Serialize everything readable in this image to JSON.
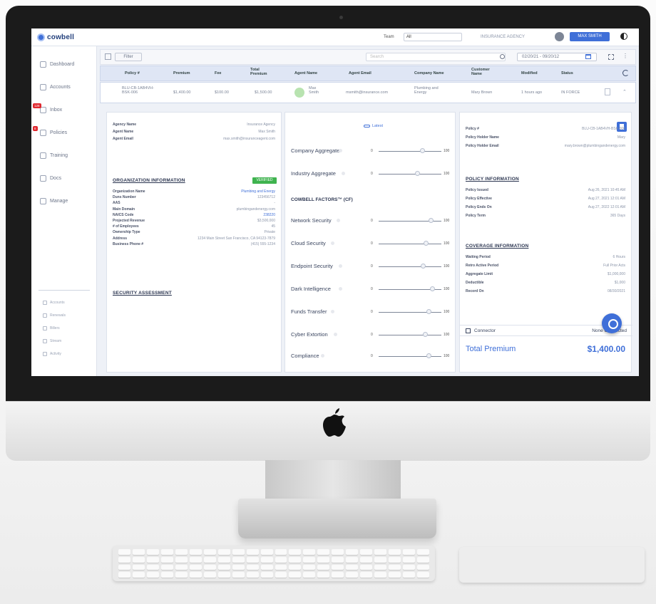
{
  "app": {
    "brand": "cowbell"
  },
  "topbar": {
    "team_label": "Team",
    "team_value": "All",
    "agency": "INSURANCE AGENCY",
    "user_button": "MAX SMITH"
  },
  "nav": [
    {
      "label": "Dashboard"
    },
    {
      "label": "Accounts"
    },
    {
      "label": "Inbox",
      "badge": "128"
    },
    {
      "label": "Policies",
      "badge": "8"
    },
    {
      "label": "Training"
    },
    {
      "label": "Docs"
    },
    {
      "label": "Manage"
    }
  ],
  "nav_secondary": [
    {
      "label": "Accounts"
    },
    {
      "label": "Renewals"
    },
    {
      "label": "Billers"
    },
    {
      "label": "Stream"
    },
    {
      "label": "Activity"
    }
  ],
  "filterbar": {
    "filter_label": "Filter",
    "search_placeholder": "Search",
    "date_range": "02/20/21 - 09/20/12"
  },
  "table": {
    "headers": [
      "Policy #",
      "Premium",
      "Fee",
      "Total Premium",
      "Agent Name",
      "Agent Email",
      "Company Name",
      "Customer Name",
      "Modified",
      "Status"
    ],
    "row": {
      "policy": "BLU-CB-1AB4VH-BSK-006",
      "premium": "$1,400.00",
      "fee": "$100.00",
      "total": "$1,500.00",
      "agent_name": "Max Smith",
      "agent_email": "msmith@insurance.com",
      "company": "Plumbing and Energy",
      "customer": "Mary Brown",
      "modified": "1 hours ago",
      "status": "IN FORCE"
    }
  },
  "left_panel": {
    "agency": [
      {
        "k": "Agency Name",
        "v": "Insurance Agency"
      },
      {
        "k": "Agent Name",
        "v": "Max Smith"
      },
      {
        "k": "Agent Email",
        "v": "max.smith@insuranceagent.com"
      }
    ],
    "org_title": "ORGANIZATION INFORMATION",
    "verified": "VERIFIED",
    "org": [
      {
        "k": "Organization Name",
        "v": "Plumbing and Energy",
        "link": true
      },
      {
        "k": "Duns Number",
        "v": "123456712"
      },
      {
        "k": "AAS",
        "v": "-"
      },
      {
        "k": "Main Domain",
        "v": "plumbingandenergy.com"
      },
      {
        "k": "NAICS Code",
        "v": "238220",
        "link": true
      },
      {
        "k": "Projected Revenue",
        "v": "$3,500,000"
      },
      {
        "k": "# of Employees",
        "v": "45"
      },
      {
        "k": "Ownership Type",
        "v": "Private"
      },
      {
        "k": "Address",
        "v": "1234 Main Street San Francisco, CA 94123-7879"
      },
      {
        "k": "Business Phone #",
        "v": "(415) 555-1234"
      }
    ],
    "security_title": "SECURITY ASSESSMENT"
  },
  "mid_panel": {
    "legend": "Latest",
    "factors_title": "COWBELL FACTORS™ (CF)",
    "range_low": "0",
    "range_high": "100",
    "factors": [
      {
        "name": "Company Aggregate",
        "value": 70
      },
      {
        "name": "Industry Aggregate",
        "value": 62
      },
      {
        "name": "Network Security",
        "value": 84
      },
      {
        "name": "Cloud Security",
        "value": 76
      },
      {
        "name": "Endpoint Security",
        "value": 71
      },
      {
        "name": "Dark Intelligence",
        "value": 86
      },
      {
        "name": "Funds Transfer",
        "value": 80
      },
      {
        "name": "Cyber Extortion",
        "value": 74
      },
      {
        "name": "Compliance",
        "value": 80
      }
    ]
  },
  "right_panel": {
    "policy": [
      {
        "k": "Policy #",
        "v": "BLU-CB-1AB4VH-BSK-006"
      },
      {
        "k": "Policy Holder Name",
        "v": "Mary"
      },
      {
        "k": "Policy Holder Email",
        "v": "mary.brown@plumbingandenergy.com"
      }
    ],
    "policy_title": "POLICY INFORMATION",
    "policy_info": [
      {
        "k": "Policy Issued",
        "v": "Aug 26, 2021 10:45 AM"
      },
      {
        "k": "Policy Effective",
        "v": "Aug 27, 2021 12:01 AM"
      },
      {
        "k": "Policy Ends On",
        "v": "Aug 27, 2022 12:01 AM"
      },
      {
        "k": "Policy Term",
        "v": "365 Days"
      }
    ],
    "coverage_title": "COVERAGE INFORMATION",
    "coverage": [
      {
        "k": "Waiting Period",
        "v": "6 Hours"
      },
      {
        "k": "Retro Active Period",
        "v": "Full Prior Acts"
      },
      {
        "k": "Aggregate Limit",
        "v": "$1,000,000"
      },
      {
        "k": "Deductible",
        "v": "$1,000"
      },
      {
        "k": "Record On",
        "v": "08/30/2021"
      }
    ],
    "connector_label": "Connector",
    "connector_value": "None Connected",
    "total_label": "Total Premium",
    "total_value": "$1,400.00"
  },
  "colors": {
    "accent": "#3f6fd8",
    "verified": "#3fb34f",
    "badge": "#e0272e"
  }
}
